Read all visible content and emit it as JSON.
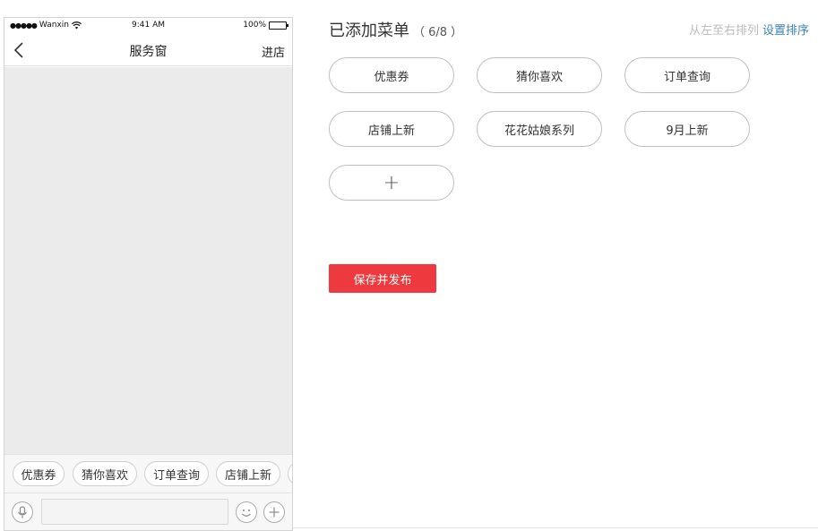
{
  "phone": {
    "status_bar": {
      "signal": "●●●●●",
      "carrier": "Wanxin",
      "time": "9:41 AM",
      "battery_percent": "100%"
    },
    "nav": {
      "back_icon": "chevron-left-icon",
      "title": "服务窗",
      "right_label": "进店"
    },
    "menu_strip": [
      "优惠券",
      "猜你喜欢",
      "订单查询",
      "店铺上新"
    ],
    "input_bar": {
      "voice_icon": "microphone-icon",
      "emoji_icon": "smiley-icon",
      "plus_icon": "plus-circle-icon"
    }
  },
  "panel": {
    "title": "已添加菜单",
    "count": "（ 6/8 ）",
    "sort_order": "从左至右排列",
    "sort_link": "设置排序",
    "menus": [
      "优惠券",
      "猜你喜欢",
      "订单查询",
      "店铺上新",
      "花花姑娘系列",
      "9月上新"
    ],
    "add_symbol": "+",
    "publish_label": "保存并发布"
  },
  "colors": {
    "accent_red": "#ee3a3e",
    "link_blue": "#3b80b8",
    "chat_bg": "#ebebeb"
  }
}
